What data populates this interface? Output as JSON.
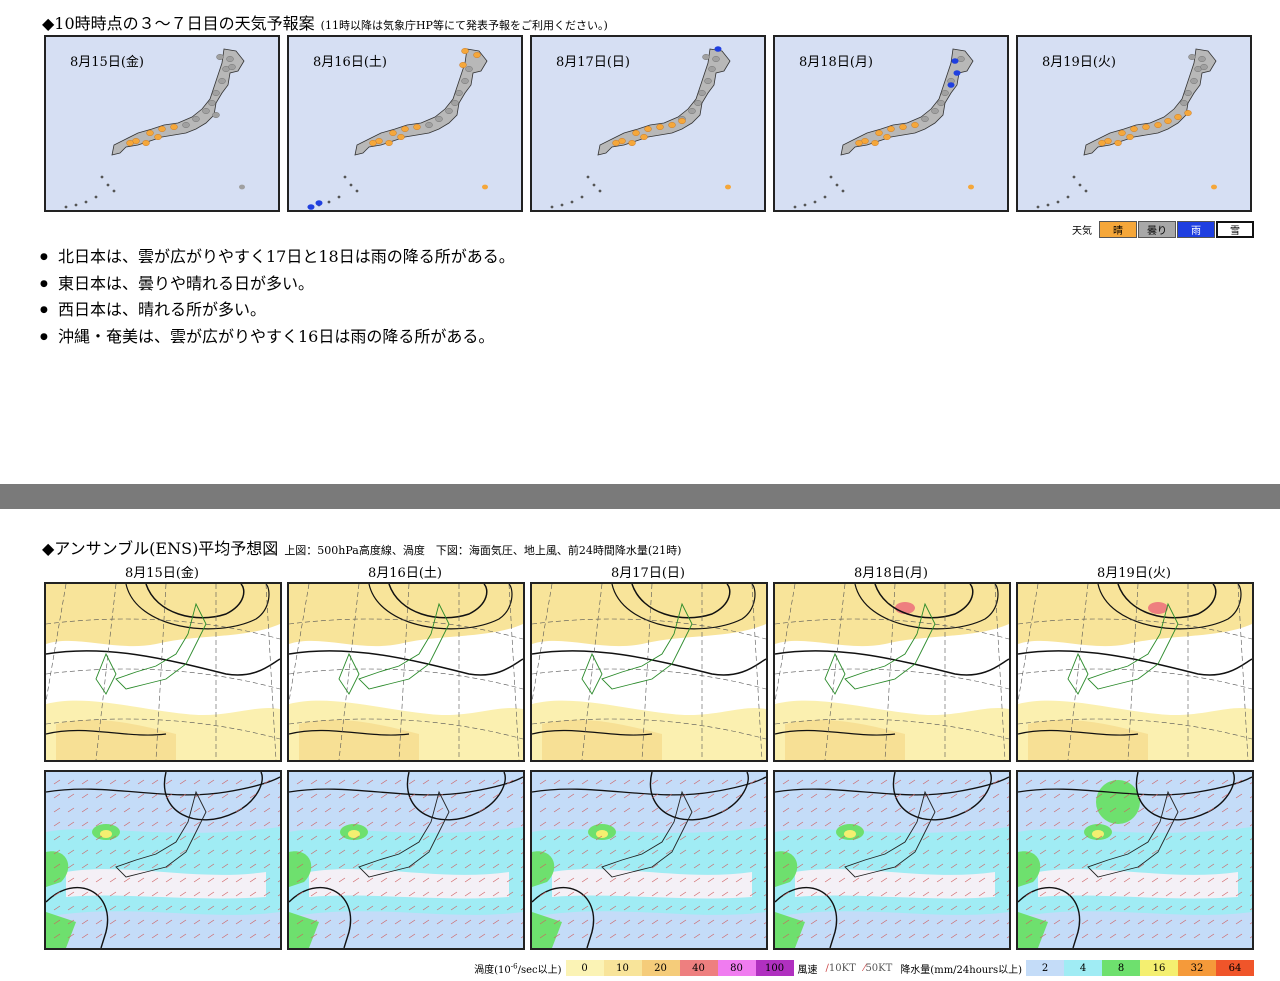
{
  "forecast": {
    "title": "◆10時時点の３～７日目の天気予報案",
    "note": "(11時以降は気象庁HP等にて発表予報をご利用ください。)",
    "days": [
      {
        "date": "8月15日(金)"
      },
      {
        "date": "8月16日(土)"
      },
      {
        "date": "8月17日(日)"
      },
      {
        "date": "8月18日(月)"
      },
      {
        "date": "8月19日(火)"
      }
    ],
    "legend": {
      "label": "天気",
      "items": [
        {
          "label": "晴",
          "color": "#f5a73a"
        },
        {
          "label": "曇り",
          "color": "#a8a8a8"
        },
        {
          "label": "雨",
          "color": "#1f3fe0"
        },
        {
          "label": "雪",
          "color": "#ffffff"
        }
      ]
    },
    "bullets": [
      "北日本は、雲が広がりやすく17日と18日は雨の降る所がある。",
      "東日本は、曇りや晴れる日が多い。",
      "西日本は、晴れる所が多い。",
      "沖縄・奄美は、雲が広がりやすく16日は雨の降る所がある。"
    ]
  },
  "ensemble": {
    "title": "◆アンサンブル(ENS)平均予想図",
    "note": "上図：500hPa高度線、渦度　下図：海面気圧、地上風、前24時間降水量(21時)",
    "days": [
      {
        "date": "8月15日(金)"
      },
      {
        "date": "8月16日(土)"
      },
      {
        "date": "8月17日(日)"
      },
      {
        "date": "8月18日(月)"
      },
      {
        "date": "8月19日(火)"
      }
    ],
    "legend": {
      "vorticity_label": "渦度(10",
      "vorticity_exp": "-6",
      "vorticity_tail": "/sec以上)",
      "vorticity_items": [
        {
          "label": "0",
          "color": "#fbf3b5"
        },
        {
          "label": "10",
          "color": "#f8e49a"
        },
        {
          "label": "20",
          "color": "#f5cc7a"
        },
        {
          "label": "40",
          "color": "#ee7f7f"
        },
        {
          "label": "80",
          "color": "#f07cf0"
        },
        {
          "label": "100",
          "color": "#b030c0"
        }
      ],
      "wind_label": "風速",
      "wind_10": "10KT",
      "wind_50": "50KT",
      "precip_label": "降水量(mm/24hours以上)",
      "precip_items": [
        {
          "label": "2",
          "color": "#c4dcf8"
        },
        {
          "label": "4",
          "color": "#a0ecf4"
        },
        {
          "label": "8",
          "color": "#6ee06e"
        },
        {
          "label": "16",
          "color": "#f4ef70"
        },
        {
          "label": "32",
          "color": "#f59a3a"
        },
        {
          "label": "64",
          "color": "#f0552a"
        }
      ]
    }
  }
}
